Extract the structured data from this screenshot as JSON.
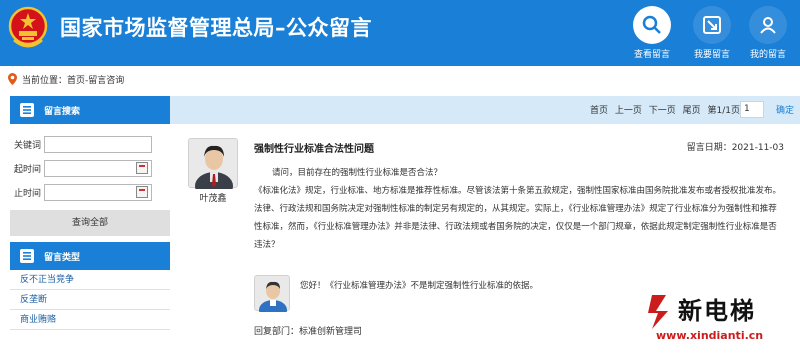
{
  "header": {
    "title": "国家市场监督管理总局–公众留言",
    "nav": [
      {
        "label": "查看留言",
        "icon": "search-icon"
      },
      {
        "label": "我要留言",
        "icon": "edit-icon"
      },
      {
        "label": "我的留言",
        "icon": "user-icon"
      }
    ]
  },
  "breadcrumb": {
    "label": "当前位置",
    "path": "首页-留言咨询"
  },
  "sidebar": {
    "search_title": "留言搜索",
    "fields": [
      {
        "label": "关键词",
        "value": ""
      },
      {
        "label": "起时间",
        "value": ""
      },
      {
        "label": "止时间",
        "value": ""
      }
    ],
    "query_all": "查询全部",
    "types_title": "留言类型",
    "types": [
      "反不正当竞争",
      "反垄断",
      "商业贿赂"
    ]
  },
  "pager": {
    "first": "首页",
    "prev": "上一页",
    "next": "下一页",
    "last": "尾页",
    "page_info": "第1/1页",
    "page_input": "1",
    "go": "确定"
  },
  "message": {
    "poster": "叶茂鑫",
    "title": "强制性行业标准合法性问题",
    "date": "留言日期：2021-11-03",
    "body_1": "请问，目前存在的强制性行业标准是否合法？",
    "body_2": "《标准化法》规定，行业标准、地方标准是推荐性标准。尽管该法第十条第五款规定，强制性国家标准由国务院批准发布或者授权批准发布。法律、行政法规和国务院决定对强制性标准的制定另有规定的，从其规定。实际上，《行业标准管理办法》规定了行业标准分为强制性和推荐性标准，然而，《行业标准管理办法》并非是法律、行政法规或者国务院的决定，仅仅是一个部门规章，依据此规定制定强制性行业标准是否违法？",
    "reply": "您好！《行业标准管理办法》不是制定强制性行业标准的依据。",
    "reply_dept": "回复部门：标准创新管理司"
  },
  "watermark": {
    "brand": "新电梯",
    "url": "www.xindianti.cn"
  },
  "colors": {
    "header_blue": "#1a7fd6",
    "pager_bg": "#d6e9f8",
    "watermark_red": "#cc1d1d"
  }
}
